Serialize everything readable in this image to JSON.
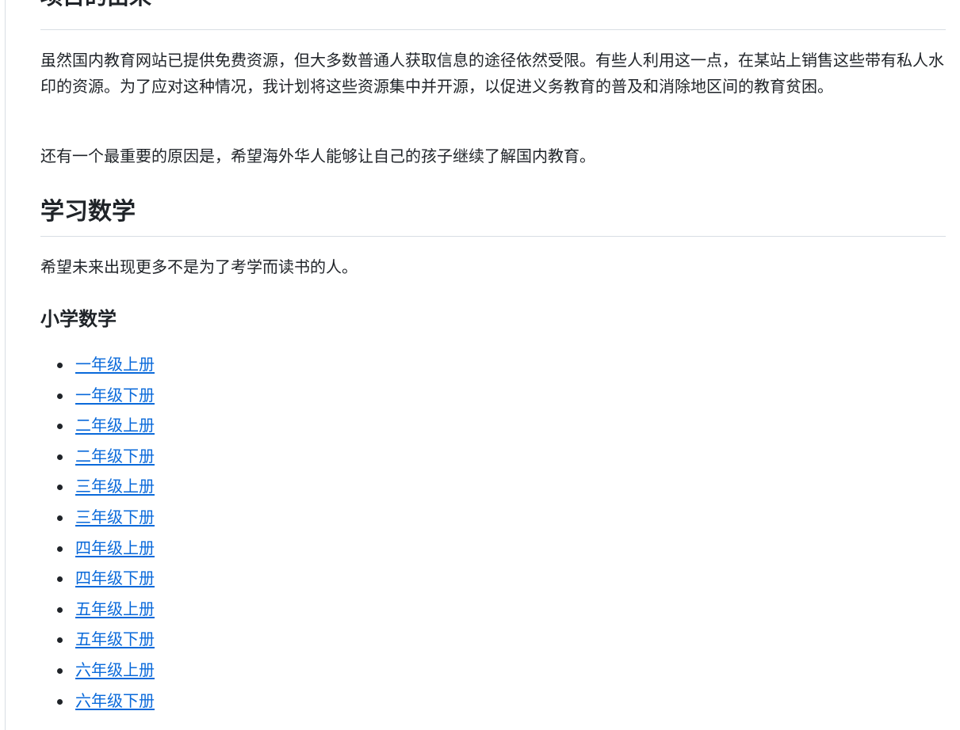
{
  "section_origin": {
    "title": "项目的由来",
    "paragraphs": [
      "虽然国内教育网站已提供免费资源，但大多数普通人获取信息的途径依然受限。有些人利用这一点，在某站上销售这些带有私人水印的资源。为了应对这种情况，我计划将这些资源集中并开源，以促进义务教育的普及和消除地区间的教育贫困。",
      "还有一个最重要的原因是，希望海外华人能够让自己的孩子继续了解国内教育。"
    ]
  },
  "section_math": {
    "title": "学习数学",
    "intro": "希望未来出现更多不是为了考学而读书的人。"
  },
  "section_primary": {
    "title": "小学数学",
    "links": [
      "一年级上册",
      "一年级下册",
      "二年级上册",
      "二年级下册",
      "三年级上册",
      "三年级下册",
      "四年级上册",
      "四年级下册",
      "五年级上册",
      "五年级下册",
      "六年级上册",
      "六年级下册"
    ]
  },
  "colors": {
    "text": "#1f2328",
    "link": "#0969da",
    "rule": "#d8dee4"
  }
}
